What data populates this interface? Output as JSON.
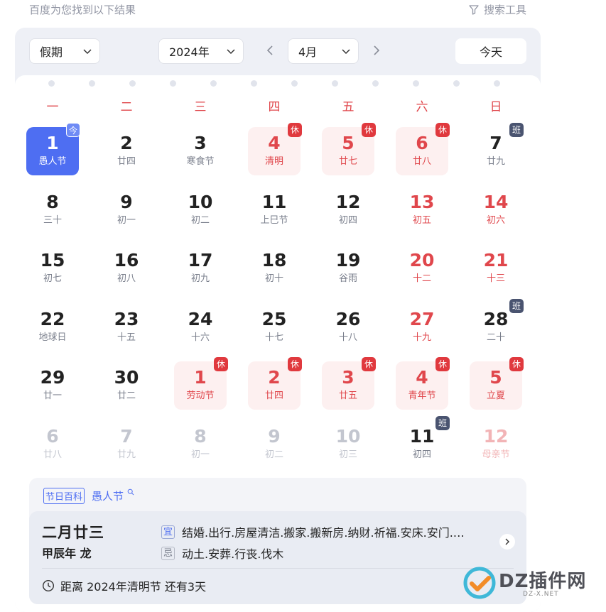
{
  "header": {
    "hint": "百度为您找到以下结果",
    "tools_label": "搜索工具"
  },
  "controls": {
    "holiday": "假期",
    "year": "2024年",
    "month": "4月",
    "today": "今天"
  },
  "weekdays": [
    "一",
    "二",
    "三",
    "四",
    "五",
    "六",
    "日"
  ],
  "weeks": [
    [
      {
        "day": "1",
        "sub": "愚人节",
        "state": "selected",
        "badge": "今"
      },
      {
        "day": "2",
        "sub": "廿四"
      },
      {
        "day": "3",
        "sub": "寒食节"
      },
      {
        "day": "4",
        "sub": "清明",
        "state": "rest",
        "badge": "休"
      },
      {
        "day": "5",
        "sub": "廿七",
        "state": "rest",
        "badge": "休"
      },
      {
        "day": "6",
        "sub": "廿八",
        "state": "rest",
        "badge": "休"
      },
      {
        "day": "7",
        "sub": "廿九",
        "badge": "班"
      }
    ],
    [
      {
        "day": "8",
        "sub": "三十"
      },
      {
        "day": "9",
        "sub": "初一"
      },
      {
        "day": "10",
        "sub": "初二"
      },
      {
        "day": "11",
        "sub": "上巳节"
      },
      {
        "day": "12",
        "sub": "初四"
      },
      {
        "day": "13",
        "sub": "初五",
        "state": "weekend"
      },
      {
        "day": "14",
        "sub": "初六",
        "state": "weekend"
      }
    ],
    [
      {
        "day": "15",
        "sub": "初七"
      },
      {
        "day": "16",
        "sub": "初八"
      },
      {
        "day": "17",
        "sub": "初九"
      },
      {
        "day": "18",
        "sub": "初十"
      },
      {
        "day": "19",
        "sub": "谷雨"
      },
      {
        "day": "20",
        "sub": "十二",
        "state": "weekend"
      },
      {
        "day": "21",
        "sub": "十三",
        "state": "weekend"
      }
    ],
    [
      {
        "day": "22",
        "sub": "地球日"
      },
      {
        "day": "23",
        "sub": "十五"
      },
      {
        "day": "24",
        "sub": "十六"
      },
      {
        "day": "25",
        "sub": "十七"
      },
      {
        "day": "26",
        "sub": "十八"
      },
      {
        "day": "27",
        "sub": "十九",
        "state": "weekend"
      },
      {
        "day": "28",
        "sub": "二十",
        "badge": "班"
      }
    ],
    [
      {
        "day": "29",
        "sub": "廿一"
      },
      {
        "day": "30",
        "sub": "廿二"
      },
      {
        "day": "1",
        "sub": "劳动节",
        "state": "rest",
        "badge": "休"
      },
      {
        "day": "2",
        "sub": "廿四",
        "state": "rest",
        "badge": "休"
      },
      {
        "day": "3",
        "sub": "廿五",
        "state": "rest",
        "badge": "休"
      },
      {
        "day": "4",
        "sub": "青年节",
        "state": "rest",
        "badge": "休"
      },
      {
        "day": "5",
        "sub": "立夏",
        "state": "rest",
        "badge": "休"
      }
    ],
    [
      {
        "day": "6",
        "sub": "廿八",
        "state": "other"
      },
      {
        "day": "7",
        "sub": "廿九",
        "state": "other"
      },
      {
        "day": "8",
        "sub": "初一",
        "state": "other"
      },
      {
        "day": "9",
        "sub": "初二",
        "state": "other"
      },
      {
        "day": "10",
        "sub": "初三",
        "state": "other"
      },
      {
        "day": "11",
        "sub": "初四",
        "state": "other plain",
        "badge": "班"
      },
      {
        "day": "12",
        "sub": "母亲节",
        "state": "other weekend"
      }
    ]
  ],
  "info": {
    "encyclopedia_tag": "节日百科",
    "holiday_link": "愚人节",
    "lunar_date": "二月廿三",
    "ganzhi": "甲辰年 龙",
    "yi_label": "宜",
    "yi_text": "结婚.出行.房屋清洁.搬家.搬新房.纳财.祈福.安床.安门.…",
    "ji_label": "忌",
    "ji_text": "动土.安葬.行丧.伐木",
    "countdown": "距离 2024年清明节 还有3天"
  },
  "watermark": {
    "text": "DZ插件网",
    "sub": "DZ-X.NET"
  },
  "colors": {
    "accent": "#4e6ef2",
    "holiday_red": "#e0474c",
    "rest_bg": "#fdf0f0",
    "work_badge": "#4a5470"
  }
}
